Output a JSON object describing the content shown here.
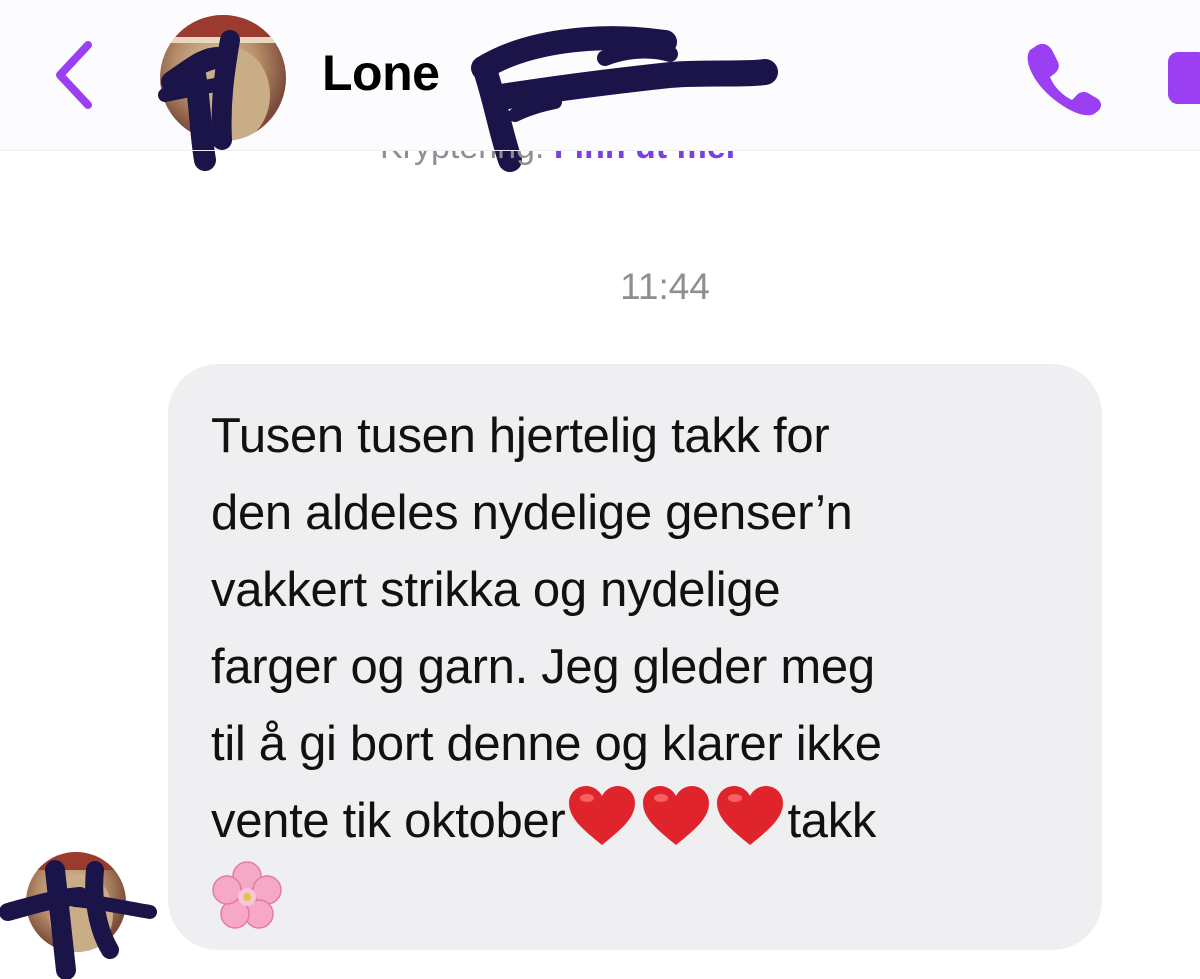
{
  "header": {
    "contact_name": "Lone",
    "back_icon": "chevron-left-icon",
    "call_icon": "phone-icon",
    "video_icon": "video-camera-icon",
    "encryption_prefix": "Kryptering.",
    "encryption_link": "Finn ut mer"
  },
  "conversation": {
    "timestamp": "11:44",
    "message": {
      "lines": [
        "Tusen tusen hjertelig takk for",
        "den aldeles nydelige genser’n",
        "vakkert strikka og nydelige",
        "farger og garn. Jeg gleder meg",
        "til å gi bort denne og klarer ikke",
        "vente tik oktober"
      ],
      "after_hearts": "takk",
      "emoji": [
        "red-heart",
        "red-heart",
        "red-heart",
        "cherry-blossom"
      ]
    }
  },
  "colors": {
    "accent": "#9a3ff2",
    "bubble": "#efeff1",
    "timestamp": "#8e8e93",
    "redaction": "#1a1448"
  }
}
